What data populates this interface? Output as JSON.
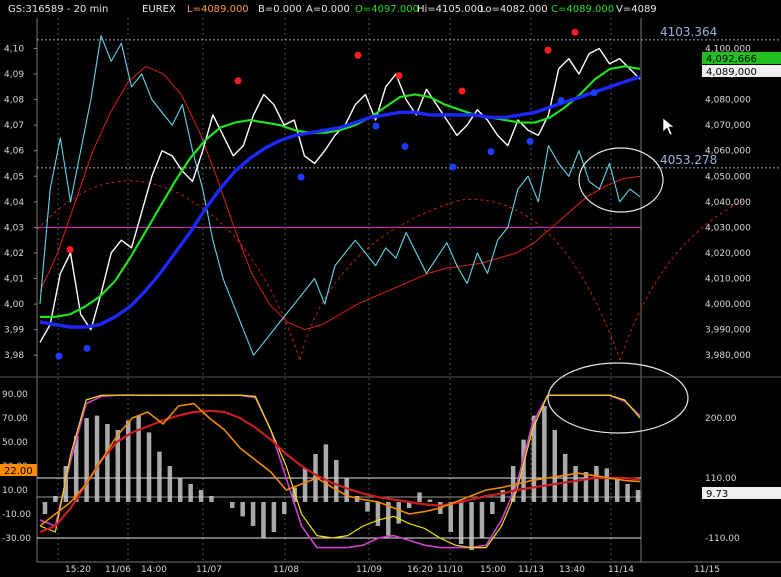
{
  "header": {
    "symbol": "GS:316589 - 20 min",
    "exchange": "EUREX",
    "last": "L=4089.000",
    "bid": "B=0.000",
    "ask": "A=0.000",
    "open": "O=4097.000",
    "high": "Hi=4105.000",
    "low": "Lo=4082.000",
    "close": "C=4089.000",
    "volume": "V=4089"
  },
  "colors": {
    "background": "#000000",
    "price": "#ffffff",
    "cyan_line": "#5fd7e6",
    "green_ma": "#22e022",
    "blue_ma": "#1c28ff",
    "red_line": "#c81e1e",
    "magenta_level": "#d040d0",
    "peak_marker": "#ff1c1c",
    "trough_marker": "#1c3cff",
    "osc_yellow": "#f0e000",
    "osc_orange": "#f08a00",
    "osc_magenta": "#d040d0",
    "hist": "#c8c8c8",
    "callout": "#e8e8e8",
    "last_price_box": "#20c020",
    "level_box": "#ff8a00"
  },
  "chart_data": [
    {
      "type": "line",
      "title": "",
      "y_ticks": [
        "4,10",
        "4,09",
        "4,08",
        "4,07",
        "4,06",
        "4,05",
        "4,04",
        "4,03",
        "4,02",
        "4,01",
        "4,00",
        "3,99",
        "3,98"
      ],
      "right_ticks": [
        "4,100,000",
        "4,090,000",
        "4,080,000",
        "4,070,000",
        "4,060,000",
        "4,050,000",
        "4,040,000",
        "4,030,000",
        "4,020,000",
        "4,010,000",
        "4,000,000",
        "3,990,000",
        "3,980,000"
      ],
      "ylim": [
        3.975,
        4.108
      ],
      "x_labels": [
        "15:20",
        "11/06",
        "14:00",
        "11/07",
        "11/08",
        "11/09",
        "16:20",
        "11/10",
        "15:00",
        "11/13",
        "13:40",
        "11/14",
        "11/15"
      ],
      "reference_levels": [
        {
          "label": "4103.364",
          "value": 4.103364
        },
        {
          "label": "4053.278",
          "value": 4.053278
        }
      ],
      "magenta_level": 4.03,
      "price_labels": [
        "4,092,666",
        "4,089,000"
      ],
      "series": [
        {
          "key": "price",
          "values": [
            3.985,
            3.992,
            4.012,
            4.02,
            3.996,
            3.99,
            4.004,
            4.02,
            4.025,
            4.022,
            4.036,
            4.05,
            4.06,
            4.058,
            4.052,
            4.048,
            4.06,
            4.074,
            4.066,
            4.058,
            4.062,
            4.074,
            4.082,
            4.078,
            4.07,
            4.072,
            4.058,
            4.055,
            4.06,
            4.066,
            4.07,
            4.078,
            4.082,
            4.072,
            4.085,
            4.09,
            4.08,
            4.074,
            4.084,
            4.078,
            4.072,
            4.066,
            4.07,
            4.076,
            4.072,
            4.066,
            4.062,
            4.072,
            4.068,
            4.066,
            4.074,
            4.092,
            4.096,
            4.09,
            4.098,
            4.1,
            4.094,
            4.096,
            4.092,
            4.088
          ]
        },
        {
          "key": "cyan",
          "values": [
            4.0,
            4.045,
            4.065,
            4.04,
            4.06,
            4.08,
            4.105,
            4.095,
            4.102,
            4.085,
            4.09,
            4.08,
            4.075,
            4.07,
            4.078,
            4.06,
            4.045,
            4.025,
            4.01,
            4.0,
            3.99,
            3.98,
            3.985,
            3.99,
            3.995,
            4.0,
            4.005,
            4.01,
            4.0,
            4.015,
            4.02,
            4.025,
            4.02,
            4.015,
            4.022,
            4.018,
            4.028,
            4.02,
            4.012,
            4.018,
            4.024,
            4.015,
            4.008,
            4.02,
            4.012,
            4.025,
            4.03,
            4.045,
            4.05,
            4.04,
            4.062,
            4.055,
            4.05,
            4.06,
            4.048,
            4.045,
            4.055,
            4.04,
            4.045,
            4.042
          ]
        },
        {
          "key": "green",
          "values": [
            3.995,
            3.995,
            3.996,
            3.999,
            4.003,
            4.009,
            4.018,
            4.028,
            4.038,
            4.048,
            4.057,
            4.064,
            4.069,
            4.071,
            4.072,
            4.071,
            4.07,
            4.068,
            4.067,
            4.067,
            4.068,
            4.07,
            4.073,
            4.077,
            4.081,
            4.082,
            4.081,
            4.078,
            4.076,
            4.074,
            4.073,
            4.072,
            4.071,
            4.071,
            4.073,
            4.077,
            4.082,
            4.088,
            4.092,
            4.093,
            4.092
          ]
        },
        {
          "key": "blue",
          "values": [
            3.993,
            3.992,
            3.991,
            3.991,
            3.992,
            3.995,
            3.999,
            4.005,
            4.012,
            4.02,
            4.028,
            4.037,
            4.045,
            4.052,
            4.057,
            4.061,
            4.064,
            4.066,
            4.067,
            4.068,
            4.069,
            4.071,
            4.073,
            4.074,
            4.075,
            4.075,
            4.074,
            4.074,
            4.074,
            4.074,
            4.073,
            4.073,
            4.074,
            4.075,
            4.077,
            4.079,
            4.081,
            4.083,
            4.085,
            4.087,
            4.089
          ]
        },
        {
          "key": "red",
          "values": [
            4.005,
            4.02,
            4.04,
            4.06,
            4.075,
            4.087,
            4.093,
            4.09,
            4.082,
            4.068,
            4.05,
            4.03,
            4.012,
            4.0,
            3.993,
            3.99,
            3.992,
            3.996,
            4.0,
            4.003,
            4.006,
            4.009,
            4.012,
            4.014,
            4.015,
            4.016,
            4.018,
            4.02,
            4.024,
            4.03,
            4.036,
            4.042,
            4.046,
            4.049,
            4.05
          ]
        }
      ],
      "peak_markers": [
        4.019,
        4.085,
        4.095,
        4.087,
        4.081,
        4.097,
        4.104
      ],
      "trough_markers": [
        3.982,
        3.985,
        4.052,
        4.072,
        4.064,
        4.056,
        4.062,
        4.066,
        4.082,
        4.085
      ]
    },
    {
      "type": "line",
      "title": "",
      "y_ticks": [
        "90.00",
        "70.00",
        "50.00",
        "30.00",
        "10.00",
        "-10.00",
        "-30.00"
      ],
      "right_ticks": [
        "200.00",
        "110.00",
        "-110.00"
      ],
      "ylim": [
        -45,
        100
      ],
      "reference_levels": [
        {
          "label": "110.00",
          "value": 20.0
        },
        {
          "label": "-110.00",
          "value": -30.0
        }
      ],
      "value_labels": [
        "22.00",
        "9.73"
      ],
      "series": [
        {
          "key": "yellow",
          "values": [
            -20,
            -25,
            40,
            85,
            89,
            89,
            89,
            89,
            89,
            89,
            89,
            89,
            89,
            89,
            88,
            60,
            30,
            -10,
            -28,
            -30,
            -28,
            -20,
            -15,
            -12,
            -18,
            -22,
            -30,
            -36,
            -38,
            -38,
            -20,
            10,
            60,
            89,
            89,
            89,
            89,
            89,
            85,
            70
          ]
        },
        {
          "key": "magenta",
          "values": [
            -15,
            -20,
            35,
            82,
            88,
            89,
            89,
            89,
            89,
            89,
            89,
            89,
            89,
            89,
            87,
            60,
            20,
            -20,
            -38,
            -38,
            -38,
            -36,
            -30,
            -28,
            -32,
            -36,
            -38,
            -38,
            -38,
            -36,
            -15,
            15,
            65,
            89,
            89,
            89,
            89,
            89,
            84,
            72
          ]
        },
        {
          "key": "orange",
          "values": [
            -20,
            -10,
            0,
            15,
            35,
            55,
            70,
            75,
            65,
            80,
            82,
            70,
            60,
            45,
            35,
            25,
            10,
            15,
            20,
            12,
            5,
            2,
            0,
            -5,
            -10,
            -8,
            -5,
            0,
            5,
            10,
            12,
            15,
            18,
            20,
            22,
            24,
            22,
            20,
            18,
            17
          ]
        },
        {
          "key": "red",
          "values": [
            -25,
            -20,
            -5,
            15,
            35,
            50,
            58,
            63,
            68,
            72,
            75,
            76,
            75,
            70,
            62,
            52,
            40,
            30,
            22,
            16,
            11,
            7,
            4,
            2,
            0,
            -2,
            -3,
            -1,
            2,
            5,
            7,
            10,
            12,
            14,
            16,
            18,
            20,
            20,
            20,
            19
          ]
        },
        {
          "key": "histogram",
          "values": [
            -10,
            5,
            30,
            55,
            70,
            72,
            65,
            60,
            68,
            72,
            58,
            42,
            30,
            20,
            15,
            10,
            5,
            0,
            -5,
            -12,
            -20,
            -30,
            -25,
            -10,
            12,
            28,
            40,
            48,
            35,
            20,
            5,
            -8,
            -20,
            -28,
            -18,
            -5,
            8,
            2,
            -10,
            -25,
            -35,
            -40,
            -30,
            -10,
            10,
            30,
            52,
            72,
            80,
            60,
            40,
            30,
            25,
            30,
            28,
            20,
            15,
            10
          ]
        }
      ]
    }
  ]
}
